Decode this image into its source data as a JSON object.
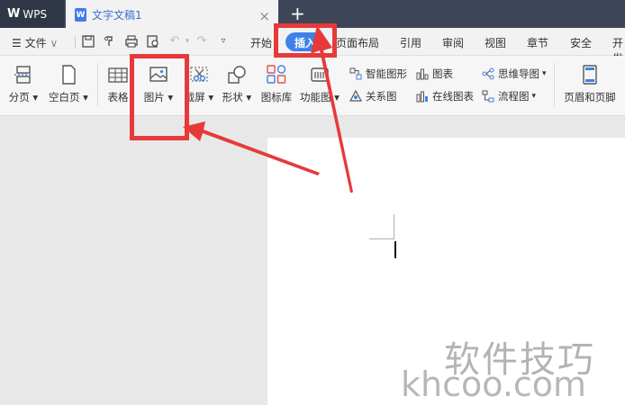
{
  "titlebar": {
    "app_name": "WPS",
    "doc_tab_title": "文字文稿1",
    "doc_icon_letter": "W",
    "close_glyph": "×",
    "new_tab_glyph": "+"
  },
  "menubar": {
    "file_label": "文件",
    "tabs": [
      "开始",
      "插入",
      "页面布局",
      "引用",
      "审阅",
      "视图",
      "章节",
      "安全",
      "开发"
    ],
    "active_tab": "插入"
  },
  "ribbon": {
    "buttons": {
      "page_break": "分页",
      "blank_page": "空白页",
      "table": "表格",
      "picture": "图片",
      "screenshot": "截屏",
      "shape": "形状",
      "icon_library": "图标库",
      "function_chart": "功能图",
      "smart_graphic": "智能图形",
      "chart": "图表",
      "relation_chart": "关系图",
      "online_chart": "在线图表",
      "mind_map": "思维导图",
      "flow_chart": "流程图",
      "header_footer": "页眉和页脚"
    }
  },
  "watermark": {
    "chinese": "软件技巧",
    "latin": "khcoo.com"
  },
  "colors": {
    "accent": "#3e82e8",
    "annotation": "#e63a3a",
    "titlebar": "#3d4658"
  }
}
